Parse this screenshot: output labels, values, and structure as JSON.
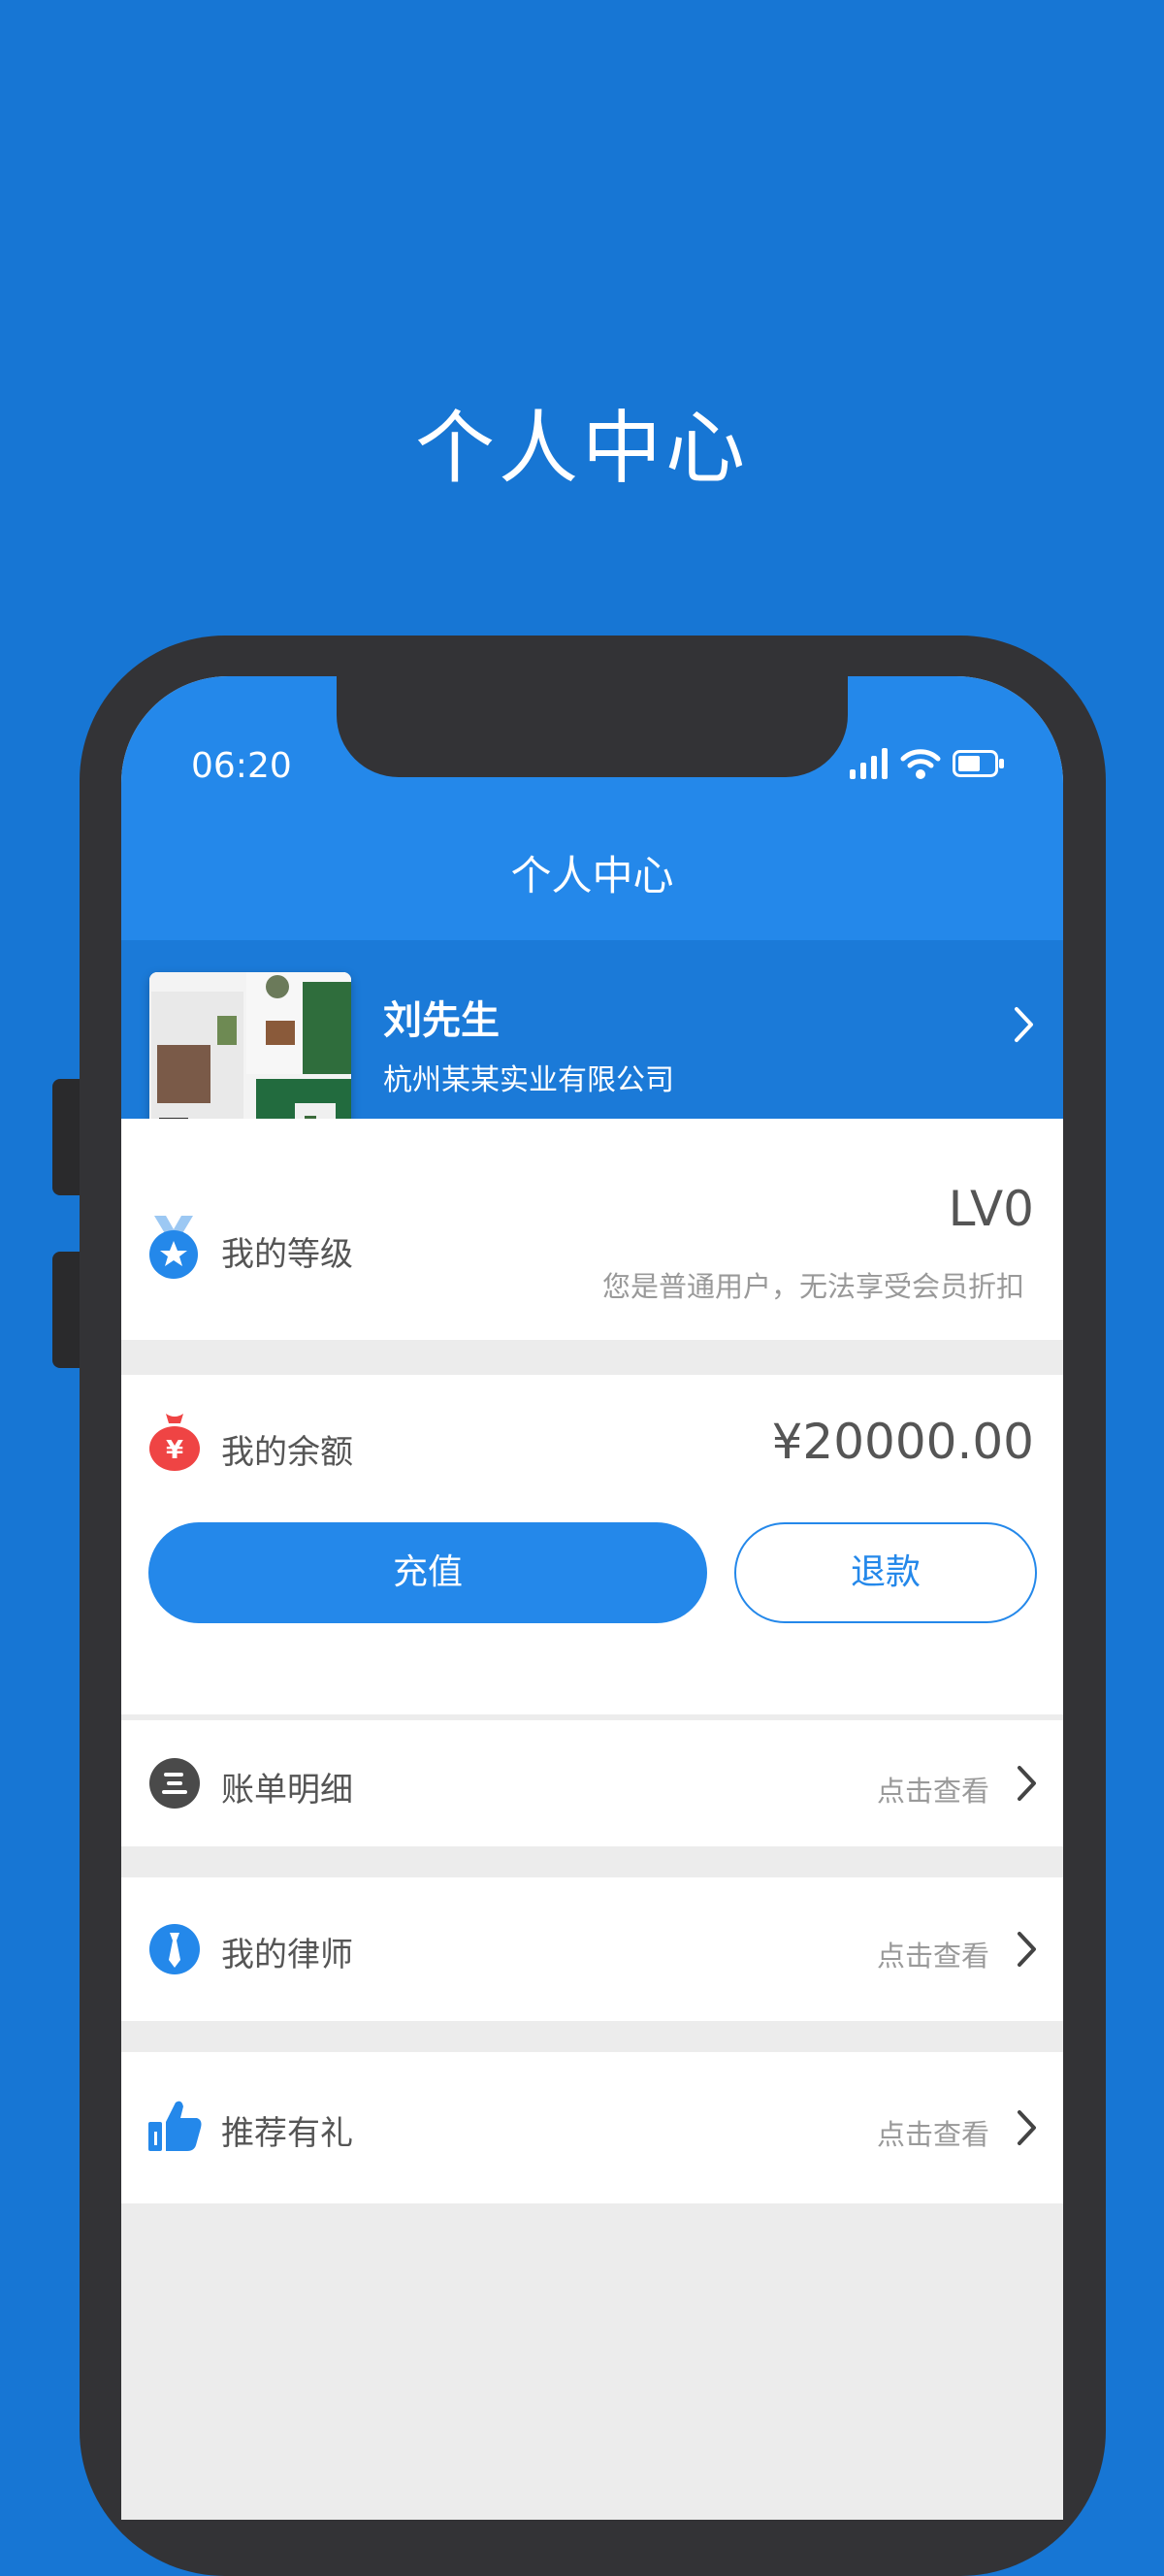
{
  "promo": {
    "title": "个人中心"
  },
  "status_bar": {
    "time": "06:20"
  },
  "nav": {
    "title": "个人中心"
  },
  "profile": {
    "name": "刘先生",
    "company": "杭州某某实业有限公司"
  },
  "level": {
    "label": "我的等级",
    "value": "LV0",
    "note": "您是普通用户，无法享受会员折扣"
  },
  "balance": {
    "label": "我的余额",
    "amount": "¥20000.00",
    "charge_label": "充值",
    "refund_label": "退款"
  },
  "menu": [
    {
      "label": "账单明细",
      "hint": "点击查看",
      "icon": "bill-icon"
    },
    {
      "label": "我的律师",
      "hint": "点击查看",
      "icon": "lawyer-tie-icon"
    },
    {
      "label": "推荐有礼",
      "hint": "点击查看",
      "icon": "thumbs-up-icon"
    }
  ],
  "colors": {
    "background": "#1776d4",
    "primary": "#2488ea",
    "profile_band": "#1b7ad8",
    "money_bag": "#ef4444"
  }
}
